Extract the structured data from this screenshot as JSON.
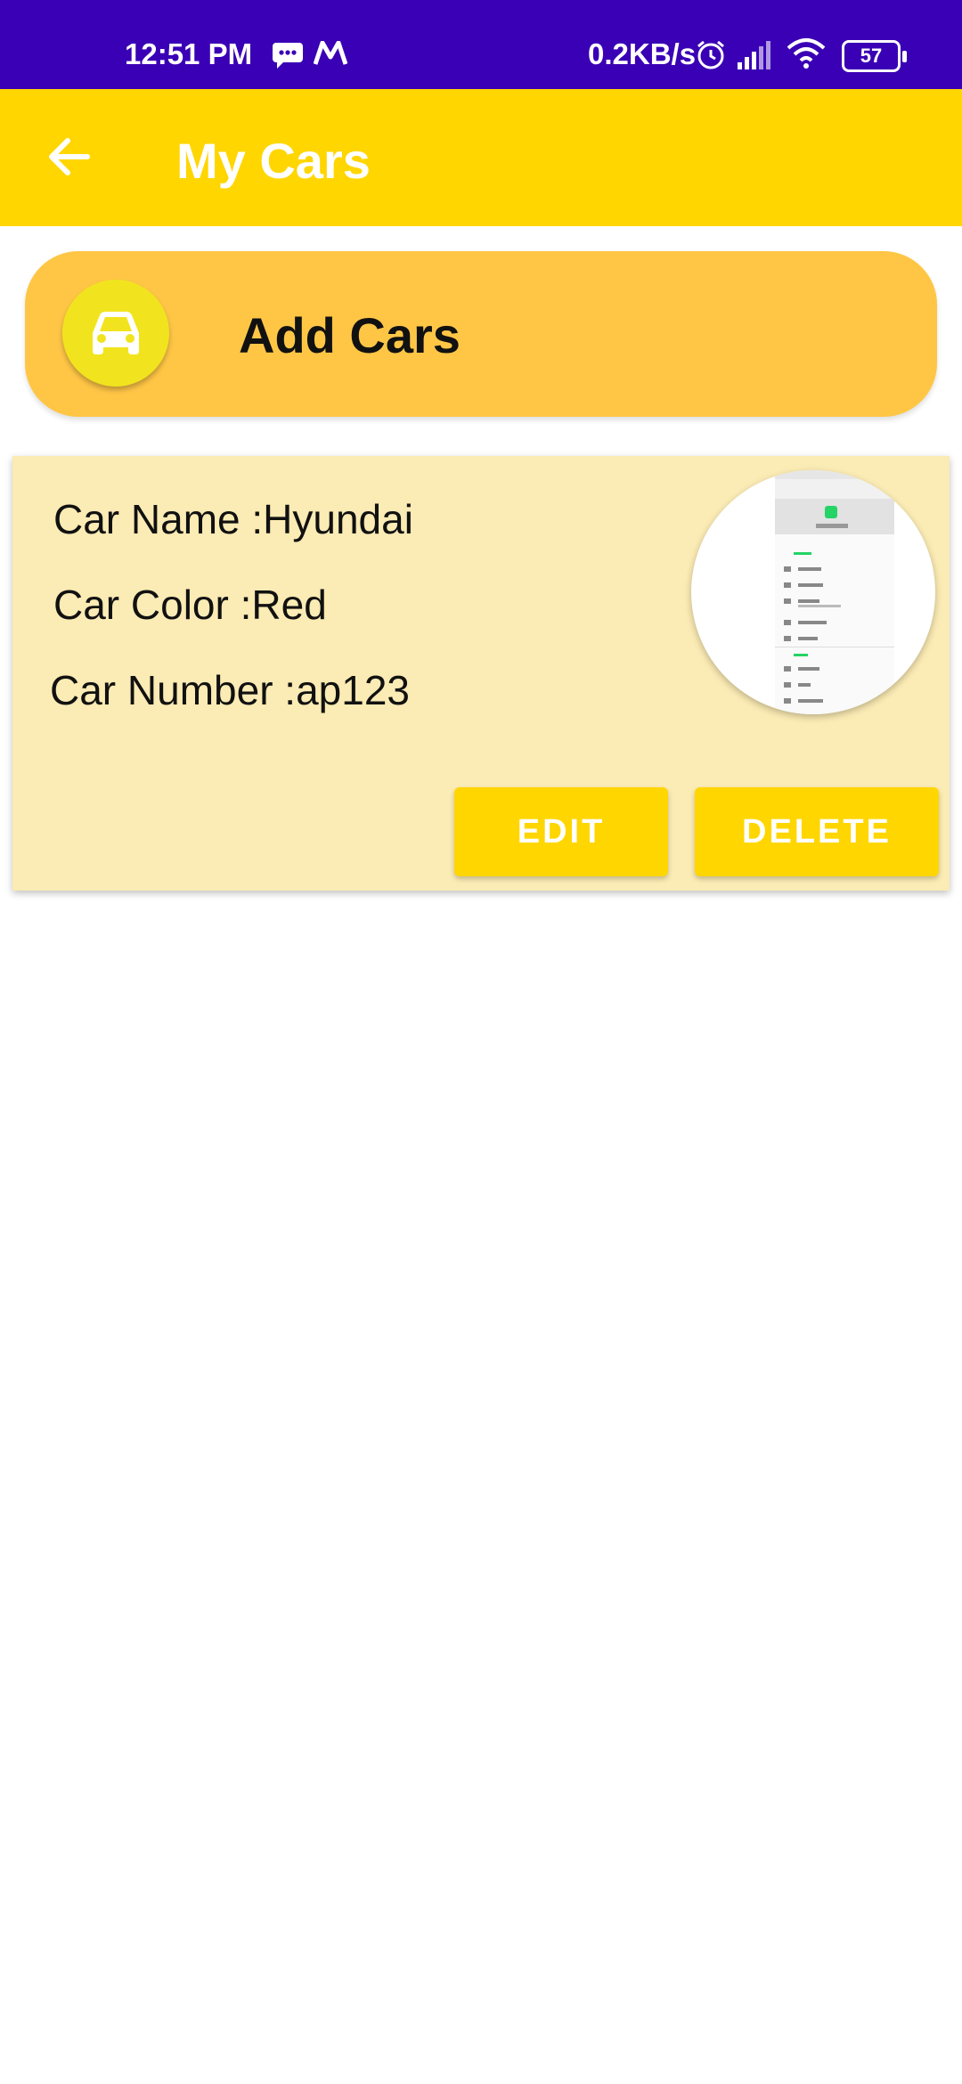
{
  "status_bar": {
    "time": "12:51 PM",
    "network_speed": "0.2KB/s",
    "battery": "57",
    "icons": [
      "message-icon",
      "m-app-icon",
      "alarm-icon",
      "signal-icon",
      "wifi-icon",
      "battery-icon"
    ]
  },
  "app_bar": {
    "title": "My Cars",
    "back_icon": "arrow-left-icon"
  },
  "add_cars": {
    "label": "Add Cars",
    "icon": "car-icon"
  },
  "cars": [
    {
      "name": "Car Name :Hyundai",
      "color": "Car Color :Red",
      "number": "Car Number :ap123",
      "edit_label": "EDIT",
      "delete_label": "DELETE"
    }
  ],
  "colors": {
    "status_bar": "#3A00B5",
    "app_bar": "#FFD600",
    "add_cars_bg": "#FFC646",
    "card_bg": "#FBEBB4",
    "button": "#FFD600"
  }
}
